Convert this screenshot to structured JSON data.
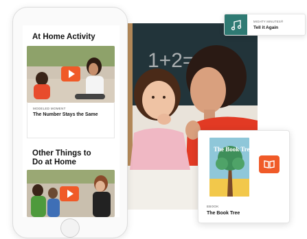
{
  "phone": {
    "section1_title": "At Home Activity",
    "card1": {
      "kicker": "MODELED MOMENT",
      "title": "The Number Stays the Same"
    },
    "section2_title": "Other Things to Do at Home"
  },
  "photo": {
    "board_text": "1+2=3"
  },
  "ebook": {
    "cover_title": "The Book Tree",
    "kicker": "EBOOK",
    "title": "The Book Tree"
  },
  "music": {
    "kicker": "MIGHTY MINUTES®",
    "title": "Tell it Again"
  },
  "colors": {
    "accent_orange": "#f05a28",
    "music_teal": "#2f7a73",
    "chalkboard": "#1f3033"
  }
}
